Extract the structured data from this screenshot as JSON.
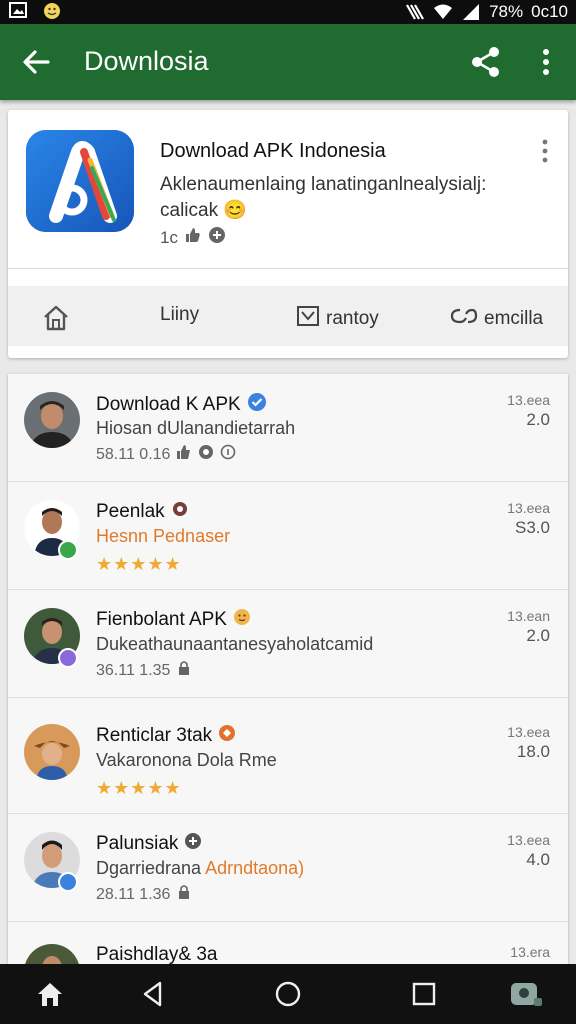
{
  "status_bar": {
    "time": "0c10",
    "battery": "78%",
    "left_icons": [
      "gallery-icon",
      "emoji-icon"
    ],
    "right_icons": [
      "nfc-icon",
      "wifi-icon",
      "signal-icon"
    ]
  },
  "app_bar": {
    "title": "Downlosia",
    "color": "#1f6b30"
  },
  "app_card": {
    "name": "Download APK Indonesia",
    "description_line1": "Aklenaumenlaing lanatinganlnealysialj:",
    "description_line2": "calicak",
    "meta_text": "1c",
    "actions": [
      {
        "label": "Liiny",
        "icon": "home-icon"
      },
      {
        "label": "Liiny",
        "icon": ""
      },
      {
        "label": "rantoy",
        "icon": "news-icon"
      },
      {
        "label": "emcilla",
        "icon": "link-icon"
      }
    ]
  },
  "list": [
    {
      "title": "Download K APK",
      "subtitle": "Hiosan dUlanandietarrah",
      "meta": "58.11  0.16",
      "date": "13.eea",
      "number": "2.0",
      "badge": "verified-icon"
    },
    {
      "title": "Peenlak",
      "subtitle": "Hesnn Pednaser",
      "rating": 5,
      "stars": "★★★★★",
      "date": "13.eea",
      "number": "S3.0"
    },
    {
      "title": "Fienbolant APK",
      "subtitle": "Dukeathaunaantanesyaholatcamid",
      "meta": "36.11  1.35",
      "date": "13.ean",
      "number": "2.0"
    },
    {
      "title": "Renticlar 3tak",
      "subtitle": "Vakaronona Dola Rme",
      "rating": 5,
      "stars": "★★★★★",
      "date": "13.eea",
      "number": "18.0"
    },
    {
      "title": "Palunsiak",
      "subtitle_a": "Dgarriedrana",
      "subtitle_b": "Adrndtaona)",
      "meta": "28.11  1.36",
      "date": "13.eea",
      "number": "4.0"
    },
    {
      "title": "Paishdlay& 3a",
      "date": "13.era"
    }
  ]
}
